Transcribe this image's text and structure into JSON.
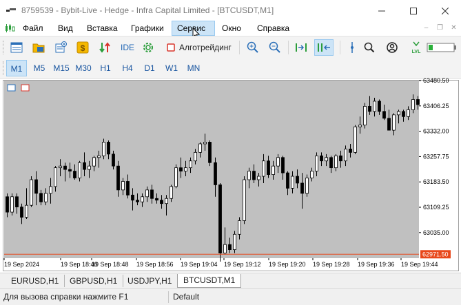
{
  "window": {
    "title": "8759539 - Bybit-Live - Hedge - Infra Capital Limited - [BTCUSDT,M1]",
    "controls": [
      "minimize",
      "maximize",
      "close"
    ]
  },
  "menu": {
    "items": [
      "Файл",
      "Вид",
      "Вставка",
      "Графики",
      "Сервис",
      "Окно",
      "Справка"
    ],
    "active_index": 4
  },
  "toolbar": {
    "ide_label": "IDE",
    "algotrading_label": "Алготрейдинг",
    "icons": [
      "new-chart-icon",
      "profiles-icon",
      "new-order-icon",
      "market-icon",
      "signals-icon",
      "ide-icon",
      "settings-icon",
      "algotrading-icon",
      "zoom-in-icon",
      "zoom-out-icon",
      "autoscroll-icon",
      "chart-shift-icon",
      "crosshair-icon",
      "search-icon",
      "account-icon",
      "level-icon",
      "battery-icon"
    ]
  },
  "timeframes": {
    "items": [
      "M1",
      "M5",
      "M15",
      "M30",
      "H1",
      "H4",
      "D1",
      "W1",
      "MN"
    ],
    "active": "M1"
  },
  "chart_data": {
    "type": "candlestick",
    "symbol": "BTCUSDT",
    "timeframe": "M1",
    "background": "#c0c0c0",
    "ylim": [
      62960,
      63480.5
    ],
    "y_ticks": [
      "63480.50",
      "63406.25",
      "63332.00",
      "63257.75",
      "63183.50",
      "63109.25",
      "63035.00"
    ],
    "x_ticks": [
      "19 Sep 2024",
      "19 Sep 18:40",
      "19 Sep 18:48",
      "19 Sep 18:56",
      "19 Sep 19:04",
      "19 Sep 19:12",
      "19 Sep 19:20",
      "19 Sep 19:28",
      "19 Sep 19:36",
      "19 Sep 19:44"
    ],
    "current_price": "62971.50",
    "current_price_color": "#e8471a",
    "bull_color": "#ffffff",
    "bear_color": "#000000",
    "candles": [
      {
        "o": 63140,
        "h": 63150,
        "l": 63080,
        "c": 63095
      },
      {
        "o": 63095,
        "h": 63150,
        "l": 63085,
        "c": 63140
      },
      {
        "o": 63140,
        "h": 63150,
        "l": 63090,
        "c": 63110
      },
      {
        "o": 63110,
        "h": 63120,
        "l": 63060,
        "c": 63080
      },
      {
        "o": 63080,
        "h": 63165,
        "l": 63075,
        "c": 63115
      },
      {
        "o": 63115,
        "h": 63200,
        "l": 63110,
        "c": 63190
      },
      {
        "o": 63190,
        "h": 63215,
        "l": 63115,
        "c": 63150
      },
      {
        "o": 63150,
        "h": 63160,
        "l": 63115,
        "c": 63125
      },
      {
        "o": 63125,
        "h": 63165,
        "l": 63115,
        "c": 63150
      },
      {
        "o": 63150,
        "h": 63195,
        "l": 63120,
        "c": 63170
      },
      {
        "o": 63170,
        "h": 63230,
        "l": 63155,
        "c": 63225
      },
      {
        "o": 63225,
        "h": 63250,
        "l": 63200,
        "c": 63230
      },
      {
        "o": 63230,
        "h": 63240,
        "l": 63185,
        "c": 63220
      },
      {
        "o": 63220,
        "h": 63240,
        "l": 63195,
        "c": 63215
      },
      {
        "o": 63215,
        "h": 63235,
        "l": 63190,
        "c": 63195
      },
      {
        "o": 63195,
        "h": 63245,
        "l": 63185,
        "c": 63240
      },
      {
        "o": 63240,
        "h": 63270,
        "l": 63200,
        "c": 63220
      },
      {
        "o": 63220,
        "h": 63245,
        "l": 63195,
        "c": 63230
      },
      {
        "o": 63230,
        "h": 63260,
        "l": 63215,
        "c": 63255
      },
      {
        "o": 63255,
        "h": 63275,
        "l": 63225,
        "c": 63260
      },
      {
        "o": 63260,
        "h": 63310,
        "l": 63250,
        "c": 63300
      },
      {
        "o": 63300,
        "h": 63305,
        "l": 63250,
        "c": 63265
      },
      {
        "o": 63265,
        "h": 63275,
        "l": 63220,
        "c": 63230
      },
      {
        "o": 63230,
        "h": 63245,
        "l": 63140,
        "c": 63160
      },
      {
        "o": 63160,
        "h": 63195,
        "l": 63145,
        "c": 63185
      },
      {
        "o": 63185,
        "h": 63205,
        "l": 63135,
        "c": 63145
      },
      {
        "o": 63145,
        "h": 63165,
        "l": 63100,
        "c": 63130
      },
      {
        "o": 63130,
        "h": 63150,
        "l": 63115,
        "c": 63125
      },
      {
        "o": 63125,
        "h": 63150,
        "l": 63110,
        "c": 63140
      },
      {
        "o": 63140,
        "h": 63170,
        "l": 63125,
        "c": 63160
      },
      {
        "o": 63160,
        "h": 63175,
        "l": 63120,
        "c": 63135
      },
      {
        "o": 63135,
        "h": 63150,
        "l": 63120,
        "c": 63130
      },
      {
        "o": 63130,
        "h": 63145,
        "l": 63105,
        "c": 63120
      },
      {
        "o": 63120,
        "h": 63145,
        "l": 63085,
        "c": 63135
      },
      {
        "o": 63135,
        "h": 63175,
        "l": 63125,
        "c": 63170
      },
      {
        "o": 63170,
        "h": 63235,
        "l": 63165,
        "c": 63225
      },
      {
        "o": 63225,
        "h": 63255,
        "l": 63195,
        "c": 63215
      },
      {
        "o": 63215,
        "h": 63245,
        "l": 63200,
        "c": 63225
      },
      {
        "o": 63225,
        "h": 63255,
        "l": 63210,
        "c": 63245
      },
      {
        "o": 63245,
        "h": 63280,
        "l": 63235,
        "c": 63270
      },
      {
        "o": 63270,
        "h": 63300,
        "l": 63255,
        "c": 63295
      },
      {
        "o": 63295,
        "h": 63325,
        "l": 63275,
        "c": 63300
      },
      {
        "o": 63300,
        "h": 63305,
        "l": 63230,
        "c": 63240
      },
      {
        "o": 63240,
        "h": 63255,
        "l": 63140,
        "c": 63175
      },
      {
        "o": 63175,
        "h": 63180,
        "l": 62950,
        "c": 62975
      },
      {
        "o": 62975,
        "h": 63050,
        "l": 62970,
        "c": 63000
      },
      {
        "o": 63000,
        "h": 63020,
        "l": 62975,
        "c": 62985
      },
      {
        "o": 62985,
        "h": 63040,
        "l": 62975,
        "c": 63030
      },
      {
        "o": 63030,
        "h": 63080,
        "l": 63015,
        "c": 63070
      },
      {
        "o": 63070,
        "h": 63200,
        "l": 63060,
        "c": 63190
      },
      {
        "o": 63190,
        "h": 63225,
        "l": 63165,
        "c": 63215
      },
      {
        "o": 63215,
        "h": 63235,
        "l": 63180,
        "c": 63190
      },
      {
        "o": 63190,
        "h": 63210,
        "l": 63170,
        "c": 63200
      },
      {
        "o": 63200,
        "h": 63265,
        "l": 63180,
        "c": 63245
      },
      {
        "o": 63245,
        "h": 63260,
        "l": 63195,
        "c": 63205
      },
      {
        "o": 63205,
        "h": 63245,
        "l": 63190,
        "c": 63230
      },
      {
        "o": 63230,
        "h": 63265,
        "l": 63210,
        "c": 63255
      },
      {
        "o": 63255,
        "h": 63260,
        "l": 63190,
        "c": 63210
      },
      {
        "o": 63210,
        "h": 63215,
        "l": 63145,
        "c": 63165
      },
      {
        "o": 63165,
        "h": 63215,
        "l": 63150,
        "c": 63200
      },
      {
        "o": 63200,
        "h": 63220,
        "l": 63165,
        "c": 63180
      },
      {
        "o": 63180,
        "h": 63210,
        "l": 63105,
        "c": 63150
      },
      {
        "o": 63150,
        "h": 63205,
        "l": 63140,
        "c": 63195
      },
      {
        "o": 63195,
        "h": 63225,
        "l": 63185,
        "c": 63215
      },
      {
        "o": 63215,
        "h": 63270,
        "l": 63200,
        "c": 63260
      },
      {
        "o": 63260,
        "h": 63270,
        "l": 63230,
        "c": 63245
      },
      {
        "o": 63245,
        "h": 63265,
        "l": 63230,
        "c": 63255
      },
      {
        "o": 63255,
        "h": 63260,
        "l": 63210,
        "c": 63225
      },
      {
        "o": 63225,
        "h": 63265,
        "l": 63215,
        "c": 63260
      },
      {
        "o": 63260,
        "h": 63275,
        "l": 63225,
        "c": 63245
      },
      {
        "o": 63245,
        "h": 63290,
        "l": 63230,
        "c": 63280
      },
      {
        "o": 63280,
        "h": 63295,
        "l": 63255,
        "c": 63270
      },
      {
        "o": 63270,
        "h": 63350,
        "l": 63265,
        "c": 63345
      },
      {
        "o": 63345,
        "h": 63375,
        "l": 63325,
        "c": 63350
      },
      {
        "o": 63350,
        "h": 63415,
        "l": 63340,
        "c": 63405
      },
      {
        "o": 63405,
        "h": 63435,
        "l": 63380,
        "c": 63390
      },
      {
        "o": 63390,
        "h": 63430,
        "l": 63375,
        "c": 63420
      },
      {
        "o": 63420,
        "h": 63425,
        "l": 63380,
        "c": 63390
      },
      {
        "o": 63390,
        "h": 63410,
        "l": 63365,
        "c": 63370
      },
      {
        "o": 63370,
        "h": 63395,
        "l": 63335,
        "c": 63335
      },
      {
        "o": 63335,
        "h": 63385,
        "l": 63320,
        "c": 63380
      },
      {
        "o": 63380,
        "h": 63395,
        "l": 63355,
        "c": 63390
      },
      {
        "o": 63390,
        "h": 63395,
        "l": 63360,
        "c": 63375
      },
      {
        "o": 63375,
        "h": 63405,
        "l": 63365,
        "c": 63395
      },
      {
        "o": 63395,
        "h": 63440,
        "l": 63385,
        "c": 63425
      },
      {
        "o": 63425,
        "h": 63435,
        "l": 63395,
        "c": 63410
      }
    ]
  },
  "symbol_tabs": {
    "items": [
      "EURUSD,H1",
      "GBPUSD,H1",
      "USDJPY,H1",
      "BTCUSDT,M1"
    ],
    "active_index": 3
  },
  "statusbar": {
    "help_text": "Для вызова справки нажмите F1",
    "profile": "Default"
  }
}
